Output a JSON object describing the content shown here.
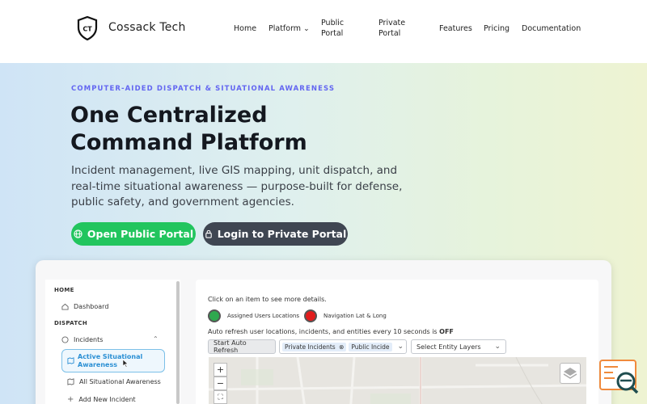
{
  "header": {
    "logo_text": "CT",
    "brand": "Cossack Tech",
    "nav": [
      {
        "label": "Home"
      },
      {
        "label": "Platform"
      },
      {
        "label": "Public Portal"
      },
      {
        "label": "Private Portal"
      },
      {
        "label": "Features"
      },
      {
        "label": "Pricing"
      },
      {
        "label": "Documentation"
      }
    ]
  },
  "hero": {
    "eyebrow": "COMPUTER-AIDED DISPATCH & SITUATIONAL AWARENESS",
    "title_line1": "One Centralized",
    "title_line2": "Command Platform",
    "subtitle": "Incident management, live GIS mapping, unit dispatch, and real-time situational awareness — purpose-built for defense, public safety, and government agencies.",
    "cta_primary": "Open Public Portal",
    "cta_secondary": "Login to Private Portal",
    "colors": {
      "primary": "#22c55e",
      "secondary": "#3f4652",
      "accent": "#6366f1"
    }
  },
  "preview": {
    "sidebar": {
      "home_heading": "HOME",
      "dashboard": "Dashboard",
      "dispatch_heading": "DISPATCH",
      "incidents": "Incidents",
      "active": "Active Situational Awareness",
      "all": "All Situational Awareness",
      "add": "Add New Incident"
    },
    "main": {
      "instruction": "Click on an item to see more details.",
      "legend_green": "Assigned Users Locations",
      "legend_red": "Navigation Lat & Long",
      "refresh_text": "Auto refresh user locations, incidents, and entities every 10 seconds is ",
      "refresh_state": "OFF",
      "start_button": "Start Auto Refresh",
      "tag_private": "Private Incidents",
      "tag_public": "Public Incide",
      "entity_select": "Select Entity Layers"
    }
  }
}
